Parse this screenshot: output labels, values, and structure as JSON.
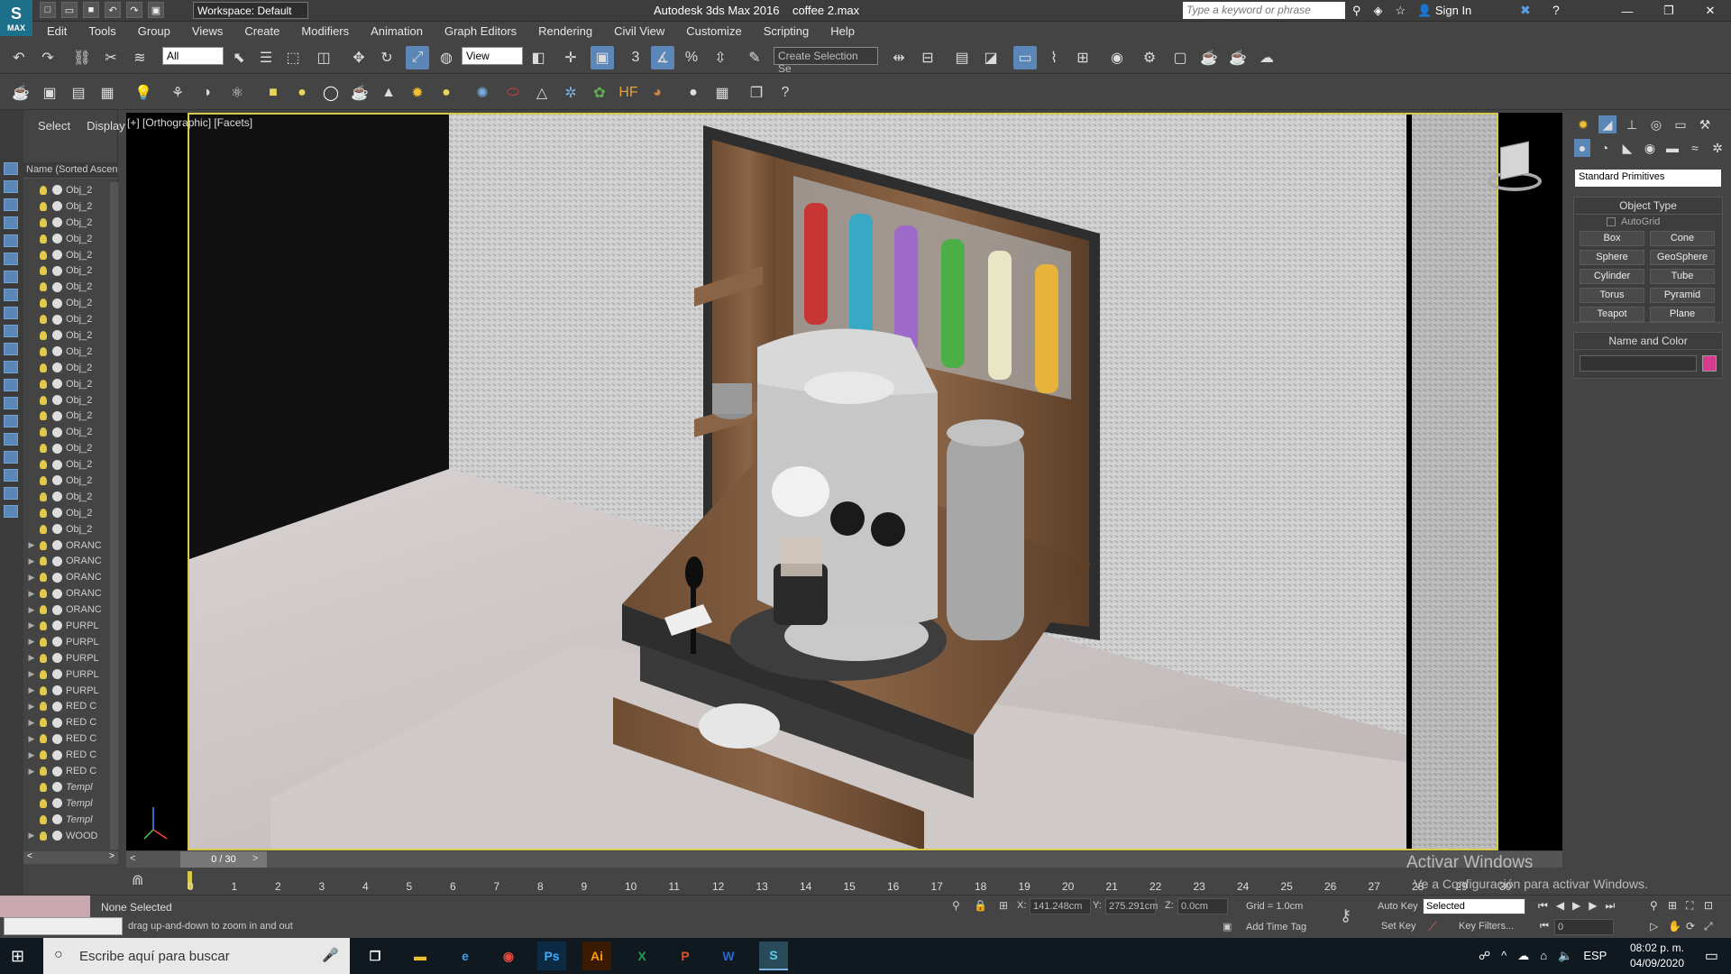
{
  "titlebar": {
    "app_title": "Autodesk 3ds Max 2016",
    "file_name": "coffee 2.max",
    "workspace": "Workspace: Default",
    "search_placeholder": "Type a keyword or phrase",
    "sign_in": "Sign In",
    "logo": "MAX"
  },
  "menu": [
    "Edit",
    "Tools",
    "Group",
    "Views",
    "Create",
    "Modifiers",
    "Animation",
    "Graph Editors",
    "Rendering",
    "Civil View",
    "Customize",
    "Scripting",
    "Help"
  ],
  "toolbar": {
    "filter": "All",
    "ref_coord": "View",
    "named_selection": "Create Selection Se",
    "snap": "3",
    "angle": "%"
  },
  "scene_explorer": {
    "tabs": [
      "Select",
      "Display"
    ],
    "header": "Name (Sorted Ascending)",
    "items": [
      "Obj_2",
      "Obj_2",
      "Obj_2",
      "Obj_2",
      "Obj_2",
      "Obj_2",
      "Obj_2",
      "Obj_2",
      "Obj_2",
      "Obj_2",
      "Obj_2",
      "Obj_2",
      "Obj_2",
      "Obj_2",
      "Obj_2",
      "Obj_2",
      "Obj_2",
      "Obj_2",
      "Obj_2",
      "Obj_2",
      "Obj_2",
      "Obj_2",
      "ORANC",
      "ORANC",
      "ORANC",
      "ORANC",
      "ORANC",
      "PURPL",
      "PURPL",
      "PURPL",
      "PURPL",
      "PURPL",
      "RED C",
      "RED C",
      "RED C",
      "RED C",
      "RED C",
      "Templ",
      "Templ",
      "Templ",
      "WOOD"
    ]
  },
  "viewport": {
    "label": "[+] [Orthographic] [Facets]"
  },
  "command_panel": {
    "category": "Standard Primitives",
    "object_type_title": "Object Type",
    "autogrid": "AutoGrid",
    "buttons": [
      "Box",
      "Cone",
      "Sphere",
      "GeoSphere",
      "Cylinder",
      "Tube",
      "Torus",
      "Pyramid",
      "Teapot",
      "Plane"
    ],
    "name_color_title": "Name and Color",
    "color_swatch": "#d63a8c"
  },
  "timeline": {
    "counter": "0 / 30",
    "frames": [
      "0",
      "1",
      "2",
      "3",
      "4",
      "5",
      "6",
      "7",
      "8",
      "9",
      "10",
      "11",
      "12",
      "13",
      "14",
      "15",
      "16",
      "17",
      "18",
      "19",
      "20",
      "21",
      "22",
      "23",
      "24",
      "25",
      "26",
      "27",
      "28",
      "29",
      "30"
    ]
  },
  "status": {
    "selection": "None Selected",
    "prompt": "drag up-and-down to zoom in and out",
    "x_label": "X:",
    "x": "141.248cm",
    "y_label": "Y:",
    "y": "275.291cm",
    "z_label": "Z:",
    "z": "0.0cm",
    "grid": "Grid = 1.0cm",
    "add_time_tag": "Add Time Tag",
    "auto_key": "Auto Key",
    "set_key": "Set Key",
    "key_mode": "Selected",
    "key_filters": "Key Filters...",
    "frame_value": "0"
  },
  "watermark": {
    "line1": "Activar Windows",
    "line2": "Ve a Configuración para activar Windows."
  },
  "taskbar": {
    "search": "Escribe aquí para buscar",
    "time": "08:02 p. m.",
    "date": "04/09/2020"
  }
}
